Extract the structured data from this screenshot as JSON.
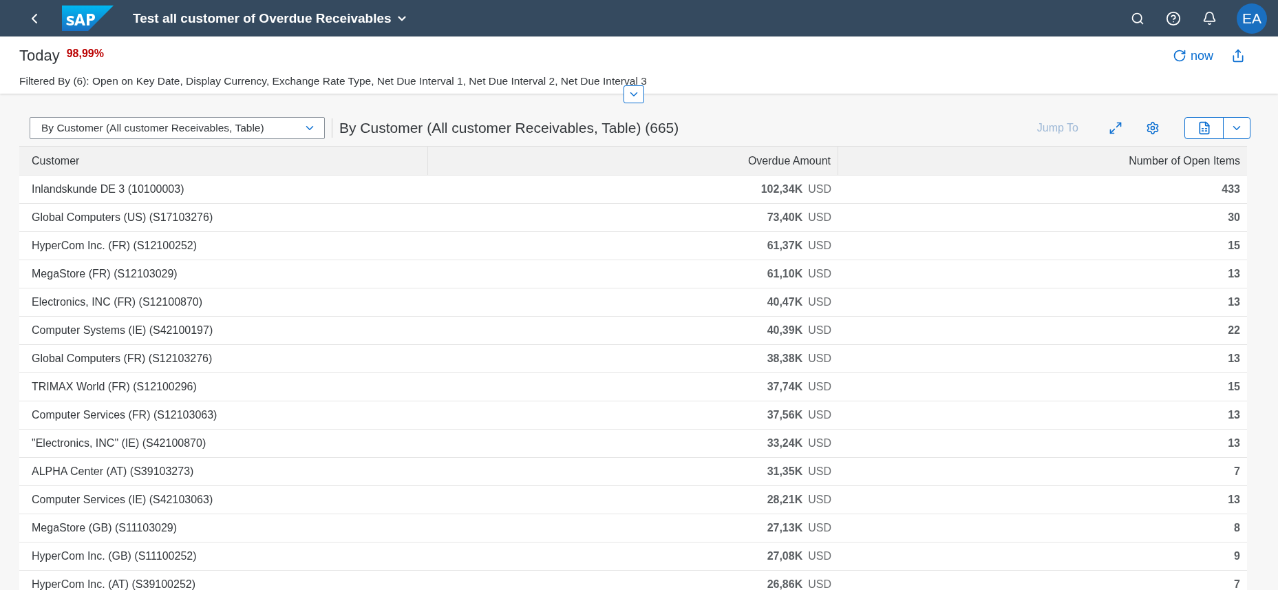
{
  "shell": {
    "title": "Test all customer of Overdue Receivables",
    "avatar": "EA"
  },
  "header": {
    "label": "Today",
    "kpi": "98,99%",
    "refresh": "now",
    "filter": "Filtered By (6): Open on Key Date, Display Currency, Exchange Rate Type, Net Due Interval 1, Net Due Interval 2, Net Due Interval 3"
  },
  "toolbar": {
    "view_select": "By Customer (All customer Receivables, Table)",
    "table_title": "By Customer (All customer Receivables, Table) (665)",
    "jump_to": {
      "label": "Jump To",
      "disabled": true
    }
  },
  "table": {
    "columns": [
      "Customer",
      "Overdue Amount",
      "Number of Open Items"
    ],
    "rows": [
      {
        "customer": "Inlandskunde DE 3 (10100003)",
        "amount": "102,34K",
        "currency": "USD",
        "count": "433"
      },
      {
        "customer": "Global Computers (US) (S17103276)",
        "amount": "73,40K",
        "currency": "USD",
        "count": "30"
      },
      {
        "customer": "HyperCom Inc. (FR) (S12100252)",
        "amount": "61,37K",
        "currency": "USD",
        "count": "15"
      },
      {
        "customer": "MegaStore (FR) (S12103029)",
        "amount": "61,10K",
        "currency": "USD",
        "count": "13"
      },
      {
        "customer": "Electronics, INC (FR) (S12100870)",
        "amount": "40,47K",
        "currency": "USD",
        "count": "13"
      },
      {
        "customer": "Computer Systems (IE) (S42100197)",
        "amount": "40,39K",
        "currency": "USD",
        "count": "22"
      },
      {
        "customer": "Global Computers (FR) (S12103276)",
        "amount": "38,38K",
        "currency": "USD",
        "count": "13"
      },
      {
        "customer": "TRIMAX World (FR) (S12100296)",
        "amount": "37,74K",
        "currency": "USD",
        "count": "15"
      },
      {
        "customer": "Computer Services (FR) (S12103063)",
        "amount": "37,56K",
        "currency": "USD",
        "count": "13"
      },
      {
        "customer": "\"Electronics, INC\" (IE) (S42100870)",
        "amount": "33,24K",
        "currency": "USD",
        "count": "13"
      },
      {
        "customer": "ALPHA Center (AT) (S39103273)",
        "amount": "31,35K",
        "currency": "USD",
        "count": "7"
      },
      {
        "customer": "Computer Services (IE) (S42103063)",
        "amount": "28,21K",
        "currency": "USD",
        "count": "13"
      },
      {
        "customer": "MegaStore (GB) (S11103029)",
        "amount": "27,13K",
        "currency": "USD",
        "count": "8"
      },
      {
        "customer": "HyperCom Inc. (GB) (S11100252)",
        "amount": "27,08K",
        "currency": "USD",
        "count": "9"
      },
      {
        "customer": "HyperCom Inc. (AT) (S39100252)",
        "amount": "26,86K",
        "currency": "USD",
        "count": "7"
      }
    ]
  }
}
